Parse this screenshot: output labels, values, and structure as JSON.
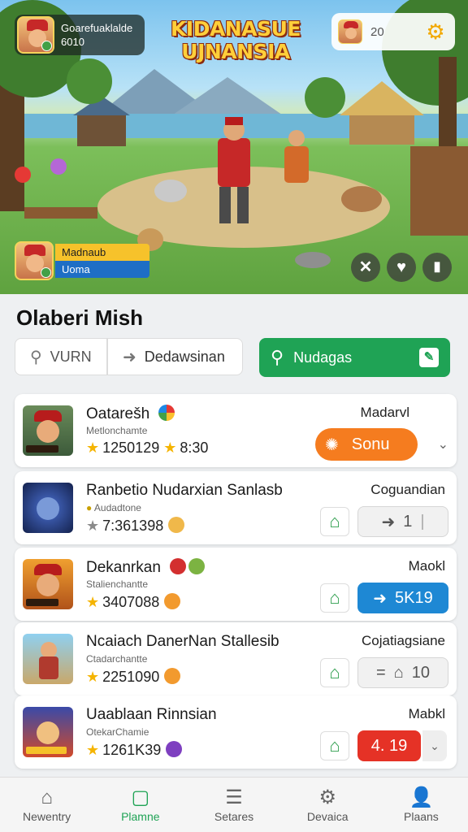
{
  "hero": {
    "game_title": "KIDANASUE UJNANSIA",
    "profile": {
      "name": "Goarefuaklalde",
      "level": "6010"
    },
    "currency": {
      "value": "20"
    },
    "player": {
      "line1": "Madnaub",
      "line2": "Uoma"
    }
  },
  "section": {
    "title": "Olaberi Mish",
    "filter_1": "VURN",
    "filter_2": "Dedawsinan",
    "action_button": "Nudagas"
  },
  "items": [
    {
      "name": "Oatarešh",
      "sub": "Metlonchamte",
      "stat1": "1250129",
      "stat2": "8:30",
      "right": "Madarvl",
      "action": "Sonu",
      "action_type": "orange"
    },
    {
      "name": "Ranbetio Nudarxian Sanlasb",
      "sub": "Audadtone",
      "stat1": "7:361398",
      "right": "Coguandian",
      "action": "1",
      "action_type": "grey"
    },
    {
      "name": "Dekanrkan",
      "sub": "Stalienchantte",
      "stat1": "3407088",
      "right": "Maokl",
      "action": "5K19",
      "action_type": "blue"
    },
    {
      "name": "Ncaiach DanerNan Stallesib",
      "sub": "Ctadarchantte",
      "stat1": "2251090",
      "right": "Cojatiagsiane",
      "action": "10",
      "action_type": "grey"
    },
    {
      "name": "Uaablaan Rinnsian",
      "sub": "OtekarChamie",
      "stat1": "1261K39",
      "right": "Mabkl",
      "action": "4. 19",
      "action_type": "red"
    }
  ],
  "nav": [
    {
      "label": "Newentry",
      "icon": "home-icon"
    },
    {
      "label": "Plamne",
      "icon": "square-icon"
    },
    {
      "label": "Setares",
      "icon": "list-icon"
    },
    {
      "label": "Devaica",
      "icon": "gear-icon"
    },
    {
      "label": "Plaans",
      "icon": "person-icon"
    }
  ],
  "colors": {
    "accent_green": "#1fa355",
    "orange": "#f57c1f",
    "blue": "#1e88d4",
    "red": "#e53226"
  }
}
